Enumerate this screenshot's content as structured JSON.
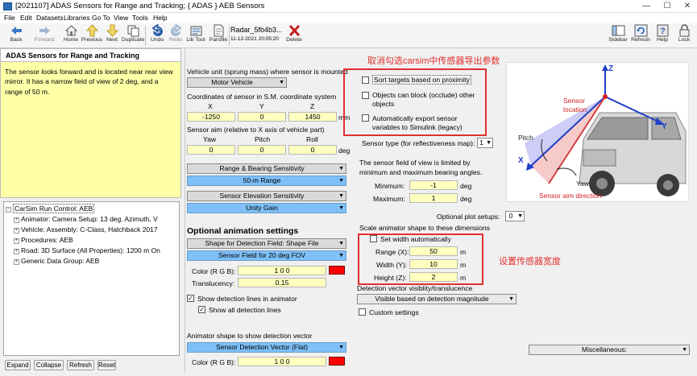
{
  "window": {
    "title": "[2021107] ADAS Sensors for Range and Tracking; { ADAS } AEB Sensors",
    "minimize": "—",
    "maximize": "☐",
    "close": "✕"
  },
  "menu": [
    "File",
    "Edit",
    "Datasets",
    "Libraries",
    "Go To",
    "View",
    "Tools",
    "Help"
  ],
  "toolbar": {
    "back": "Back",
    "forward": "Forward",
    "home": "Home",
    "previous": "Previous",
    "next": "Next",
    "duplicate": "Duplicate",
    "undo": "Undo",
    "redo": "Redo",
    "lib_tool": "Lib Tool",
    "parsfile": "Parsfile",
    "dataset_name": "Radar_5fb4b3...",
    "dataset_date": "11-12-2021 20:05:20",
    "delete": "Delete",
    "sidebar": "Sidebar",
    "refresh": "Refresh",
    "help": "Help",
    "lock": "Lock"
  },
  "left": {
    "tab_title": "ADAS Sensors for Range and Tracking",
    "description": "The sensor looks forward and is located near rear view mirror. It has a narrow field of view of 2 deg, and a range of 50 m.",
    "tree": [
      "CarSim Run Control: AEB",
      "Animator: Camera Setup: 13 deg. Azimuth, V",
      "Vehicle: Assembly: C-Class, Hatchback 2017",
      "Procedures: AEB",
      "Road: 3D Surface (All Properties): 1200 m On",
      "Generic Data Group: AEB"
    ],
    "buttons": {
      "expand": "Expand",
      "collapse": "Collapse",
      "refresh": "Refresh",
      "reset": "Reset"
    }
  },
  "main": {
    "vehicle_unit_label": "Vehicle unit (sprung mass) where sensor is mounted",
    "vehicle_unit_value": "Motor Vehicle",
    "coords_label": "Coordinates of sensor in S.M. coordinate system",
    "coord_headers": [
      "X",
      "Y",
      "Z"
    ],
    "coord_values": [
      "-1250",
      "0",
      "1450"
    ],
    "coord_unit": "mm",
    "aim_label": "Sensor aim (relative to X axis of vehicle part)",
    "aim_headers": [
      "Yaw",
      "Pitch",
      "Roll"
    ],
    "aim_values": [
      "0",
      "0",
      "0"
    ],
    "aim_unit": "deg",
    "range_sens_label": "Range & Bearing Sensitivity",
    "range_sens_value": "50-m Range",
    "elev_sens_label": "Sensor Elevation Sensitivity",
    "elev_sens_value": "Unity Gain",
    "opt_anim_title": "Optional animation settings",
    "shape_label": "Shape for Detection Field: Shape File",
    "shape_value": "Sensor Field for 20 deg FOV",
    "color_label": "Color (R G B):",
    "color_value": "1 0 0",
    "translucency_label": "Translucency:",
    "translucency_value": "0.15",
    "show_lines": "Show detection lines in animator",
    "show_all_lines": "Show all detection lines",
    "anim_vector_label": "Animator shape to show detection vector",
    "vector_value": "Sensor Detection Vector (Flat)",
    "color2_label": "Color (R G B):",
    "color2_value": "1 0 0",
    "checkbox_sort": "Sort targets based on proximity",
    "checkbox_block_1": "Objects can block (occlude) other",
    "checkbox_block_2": "objects",
    "checkbox_export_1": "Automatically export sensor",
    "checkbox_export_2": "variables to Simulink (legacy)",
    "annotation_1": "取消勾选carsim中传感器导出参数",
    "sensor_type_label": "Sensor type (for reflectiveness map):",
    "sensor_type_value": "1",
    "fov_text_1": "The sensor field of view is limited by",
    "fov_text_2": "minimum and maximum bearing angles.",
    "min_label": "Minimum:",
    "min_value": "-1",
    "max_label": "Maximum:",
    "max_value": "1",
    "deg": "deg",
    "opt_plot_label": "Optional plot setups:",
    "opt_plot_value": "0",
    "scale_label": "Scale animator shape to these dimensions",
    "set_width": "Set width automatically",
    "range_label": "Range (X):",
    "range_value": "50",
    "width_label": "Width (Y):",
    "width_value": "10",
    "height_label": "Height (Z):",
    "height_value": "2",
    "m": "m",
    "annotation_2": "设置传感器宽度",
    "det_vis_label": "Detection vector visiblity/translucence",
    "det_vis_value": "Visible based on detection magnitude",
    "custom_settings": "Custom settings",
    "misc": "Miscellaneous:"
  },
  "diagram": {
    "z": "Z",
    "y": "Y",
    "x": "X",
    "sensor_location_1": "Sensor",
    "sensor_location_2": "location",
    "pitch": "Pitch",
    "yaw": "Yaw",
    "aim_direction": "Sensor aim direction"
  }
}
